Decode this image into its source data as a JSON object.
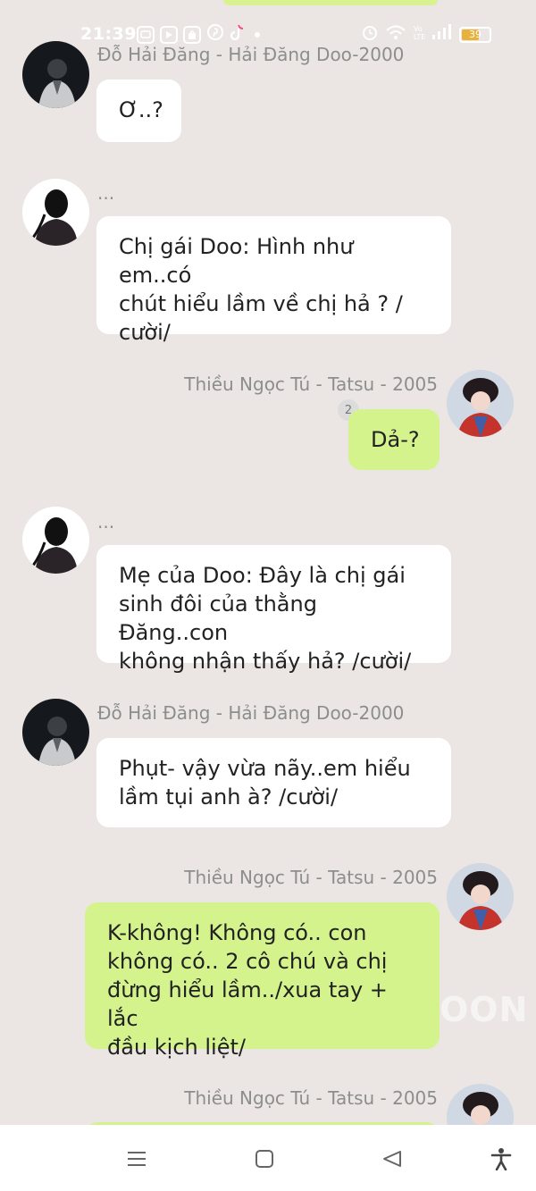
{
  "status_bar": {
    "time": "21:39",
    "left_icons": [
      "message-icon",
      "youtube-icon",
      "shopee-icon",
      "pinterest-icon",
      "tiktok-icon"
    ],
    "right_icons": [
      "alarm-icon",
      "wifi-icon",
      "lte-icon",
      "signal-icon"
    ],
    "battery": "39"
  },
  "messages": [
    {
      "side": "in",
      "avatar": "hai-dang-avatar",
      "name": "Đỗ Hải Đăng - Hải Đăng Doo-2000",
      "lines": [
        "Ơ..?"
      ]
    },
    {
      "side": "in",
      "avatar": "silhouette-avatar",
      "name": "...",
      "lines": [
        "Chị gái Doo: Hình như em..có",
        "chút hiểu lầm về chị hả ? /",
        "cười/"
      ]
    },
    {
      "side": "out",
      "avatar": "ngoc-tu-avatar",
      "name": "Thiều Ngọc Tú - Tatsu - 2005",
      "read_count": "2",
      "lines": [
        "Dả-?"
      ]
    },
    {
      "side": "in",
      "avatar": "silhouette-avatar",
      "name": "...",
      "lines": [
        "Mẹ của Doo: Đây là chị gái",
        "sinh đôi của thằng Đăng..con",
        "không nhận thấy hả? /cười/"
      ]
    },
    {
      "side": "in",
      "avatar": "hai-dang-avatar",
      "name": "Đỗ Hải Đăng - Hải Đăng Doo-2000",
      "lines": [
        "Phụt- vậy vừa nãy..em hiểu",
        "lầm tụi anh à? /cười/"
      ]
    },
    {
      "side": "out",
      "avatar": "ngoc-tu-avatar",
      "name": "Thiều Ngọc Tú - Tatsu - 2005",
      "lines": [
        "K-không! Không có.. con",
        "không có.. 2 cô chú và chị",
        "đừng hiểu lầm../xua tay + lắc",
        "đầu kịch liệt/"
      ]
    },
    {
      "side": "out",
      "avatar": "ngoc-tu-avatar",
      "name": "Thiều Ngọc Tú - Tatsu - 2005",
      "lines": []
    }
  ],
  "watermark": "OON",
  "nav_bar": {
    "items": [
      "menu-icon",
      "home-icon",
      "back-icon",
      "accessibility-icon"
    ]
  },
  "colors": {
    "background": "#ebe6e3",
    "incoming_bubble": "#ffffff",
    "outgoing_bubble": "#d4f38d",
    "name_text": "#8d8d8d"
  }
}
